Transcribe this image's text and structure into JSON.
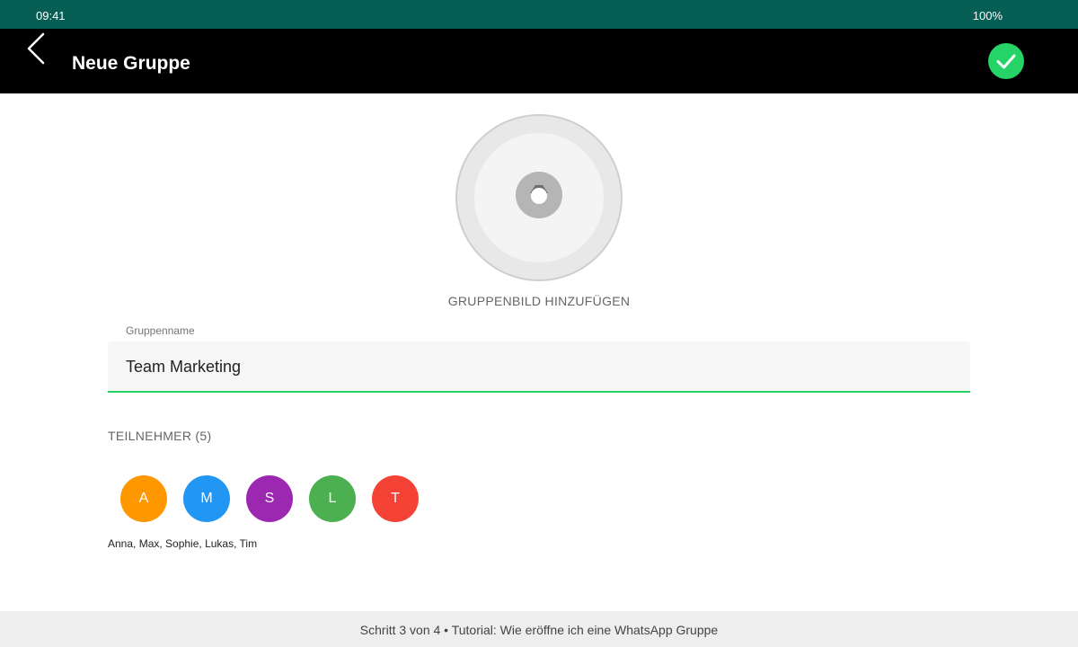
{
  "status_bar": {
    "time": "09:41",
    "battery": "100%"
  },
  "header": {
    "back_icon": "chevron-left-icon",
    "title": "Neue Gruppe",
    "confirm_icon": "check-icon",
    "confirm_color": "#25d366",
    "bar_color": "#000000"
  },
  "group_photo": {
    "icon": "camera-icon",
    "label": "GRUPPENBILD HINZUFÜGEN"
  },
  "group_name": {
    "label": "Gruppenname",
    "value": "Team Marketing",
    "accent_color": "#25d366"
  },
  "participants": {
    "heading": "TEILNEHMER (5)",
    "avatars": [
      {
        "initial": "A",
        "color": "#ff9800"
      },
      {
        "initial": "M",
        "color": "#2196f3"
      },
      {
        "initial": "S",
        "color": "#9c27b0"
      },
      {
        "initial": "L",
        "color": "#4caf50"
      },
      {
        "initial": "T",
        "color": "#f44336"
      }
    ],
    "names": "Anna, Max, Sophie, Lukas, Tim"
  },
  "footer": {
    "text": "Schritt 3 von 4 • Tutorial: Wie eröffne ich eine WhatsApp Gruppe"
  },
  "theme": {
    "status_bar_color": "#075e54"
  }
}
